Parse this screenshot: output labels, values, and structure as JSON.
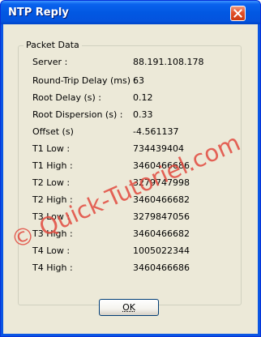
{
  "window": {
    "title": "NTP Reply"
  },
  "groupbox": {
    "label": "Packet Data"
  },
  "rows": [
    {
      "label": "Server :",
      "value": "88.191.108.178"
    },
    {
      "label": "Round-Trip Delay (ms) :",
      "value": "63"
    },
    {
      "label": "Root Delay (s) :",
      "value": "0.12"
    },
    {
      "label": "Root Dispersion (s) :",
      "value": "0.33"
    },
    {
      "label": "Offset (s)",
      "value": "-4.561137"
    },
    {
      "label": "T1 Low :",
      "value": "734439404"
    },
    {
      "label": "T1 High :",
      "value": "3460466686"
    },
    {
      "label": "T2 Low :",
      "value": "3279747998"
    },
    {
      "label": "T2 High :",
      "value": "3460466682"
    },
    {
      "label": "T3 Low :",
      "value": "3279847056"
    },
    {
      "label": "T3 High :",
      "value": "3460466682"
    },
    {
      "label": "T4 Low :",
      "value": "1005022344"
    },
    {
      "label": "T4 High :",
      "value": "3460466686"
    }
  ],
  "buttons": {
    "ok_label": "OK"
  },
  "watermark": {
    "text": "© Quick-Tutoriel.com"
  },
  "colors": {
    "titlebar": "#0258e2",
    "close": "#e2512b",
    "face": "#ece9d8",
    "watermark": "#e24a3f"
  }
}
